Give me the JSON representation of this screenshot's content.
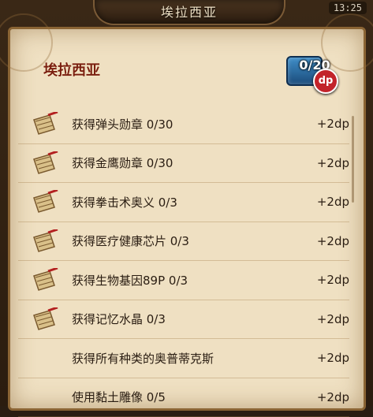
{
  "header": {
    "title": "埃拉西亚",
    "clock": "13:25"
  },
  "section": {
    "title": "埃拉西亚",
    "progress": "0/20",
    "dp_badge": "dp"
  },
  "tasks": [
    {
      "label": "获得弹头勋章 0/30",
      "reward": "+2dp",
      "icon": "scroll-icon"
    },
    {
      "label": "获得金鹰勋章 0/30",
      "reward": "+2dp",
      "icon": "scroll-icon"
    },
    {
      "label": "获得拳击术奥义 0/3",
      "reward": "+2dp",
      "icon": "scroll-icon"
    },
    {
      "label": "获得医疗健康芯片 0/3",
      "reward": "+2dp",
      "icon": "scroll-icon"
    },
    {
      "label": "获得生物基因89P 0/3",
      "reward": "+2dp",
      "icon": "scroll-icon"
    },
    {
      "label": "获得记忆水晶 0/3",
      "reward": "+2dp",
      "icon": "scroll-icon"
    },
    {
      "label": "获得所有种类的奥普蒂克斯",
      "reward": "+2dp",
      "icon": ""
    },
    {
      "label": "使用黏土雕像 0/5",
      "reward": "+2dp",
      "icon": ""
    }
  ]
}
